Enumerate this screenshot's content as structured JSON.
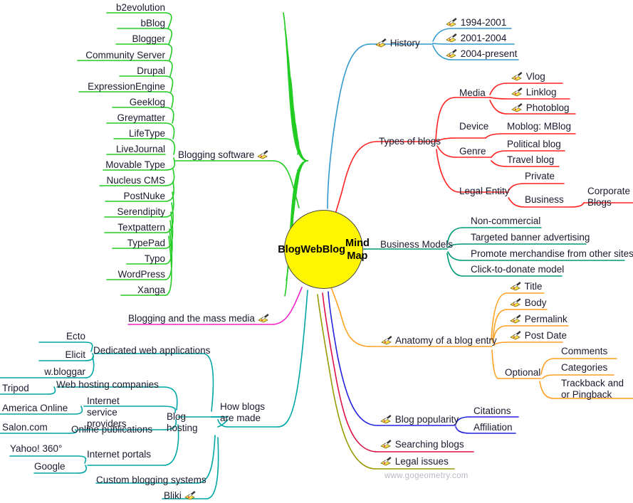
{
  "title": "Blog WebBlog Mind Map",
  "center": {
    "lines": [
      "Blog",
      "WebBlog",
      "Mind Map"
    ],
    "text": "Blog WebBlog Mind Map",
    "fill": "#FFF500",
    "stroke": "#4a4a4a"
  },
  "footer": {
    "text": "www.gogeometry.com"
  },
  "icon": {
    "name": "note-pencil-icon"
  },
  "colors": {
    "blogging_software": "#22cc22",
    "mass_media": "#ee22cc",
    "how_blogs_are_made": "#00a6a6",
    "history": "#3399cc",
    "types_of_blogs": "#ff2222",
    "business_models": "#009977",
    "anatomy": "#ffa022",
    "blog_popularity": "#2222dd",
    "searching_blogs": "#dd1144",
    "legal_issues": "#999900"
  },
  "branches": {
    "blogging_software": {
      "label": "Blogging software",
      "has_icon": true,
      "children": [
        {
          "label": "b2evolution"
        },
        {
          "label": "bBlog"
        },
        {
          "label": "Blogger"
        },
        {
          "label": "Community Server"
        },
        {
          "label": "Drupal"
        },
        {
          "label": "ExpressionEngine"
        },
        {
          "label": "Geeklog"
        },
        {
          "label": "Greymatter"
        },
        {
          "label": "LifeType"
        },
        {
          "label": "LiveJournal"
        },
        {
          "label": "Movable Type"
        },
        {
          "label": "Nucleus CMS"
        },
        {
          "label": "PostNuke"
        },
        {
          "label": "Serendipity"
        },
        {
          "label": "Textpattern"
        },
        {
          "label": "TypePad"
        },
        {
          "label": "Typo"
        },
        {
          "label": "WordPress"
        },
        {
          "label": "Xanga"
        }
      ]
    },
    "mass_media": {
      "label": "Blogging and the mass media",
      "has_icon": true
    },
    "how_blogs_are_made": {
      "label": "How blogs are made",
      "children": [
        {
          "label": "Blog hosting",
          "children": [
            {
              "label": "Dedicated web applications",
              "children": [
                {
                  "label": "Ecto"
                },
                {
                  "label": "Elicit"
                },
                {
                  "label": "w.bloggar"
                }
              ]
            },
            {
              "label": "Web hosting companies",
              "children": [
                {
                  "label": "Tripod"
                }
              ]
            },
            {
              "label": "Internet service providers",
              "children": [
                {
                  "label": "America Online"
                }
              ]
            },
            {
              "label": "Online publications",
              "children": [
                {
                  "label": "Salon.com"
                }
              ]
            },
            {
              "label": "Internet portals",
              "children": [
                {
                  "label": "Yahoo! 360°"
                },
                {
                  "label": "Google"
                }
              ]
            }
          ]
        },
        {
          "label": "Custom blogging systems"
        },
        {
          "label": "Bliki",
          "has_icon": true
        }
      ]
    },
    "history": {
      "label": "History",
      "has_icon": true,
      "children": [
        {
          "label": "1994-2001",
          "has_icon": true
        },
        {
          "label": "2001-2004",
          "has_icon": true
        },
        {
          "label": "2004-present",
          "has_icon": true
        }
      ]
    },
    "types_of_blogs": {
      "label": "Types of blogs",
      "children": [
        {
          "label": "Media",
          "children": [
            {
              "label": "Vlog",
              "has_icon": true
            },
            {
              "label": "Linklog",
              "has_icon": true
            },
            {
              "label": "Photoblog",
              "has_icon": true
            }
          ]
        },
        {
          "label": "Device",
          "children": [
            {
              "label": "Moblog: MBlog"
            }
          ]
        },
        {
          "label": "Genre",
          "children": [
            {
              "label": "Political blog"
            },
            {
              "label": "Travel blog"
            }
          ]
        },
        {
          "label": "Legal Entity",
          "children": [
            {
              "label": "Private"
            },
            {
              "label": "Business",
              "children": [
                {
                  "label": "Corporate Blogs"
                }
              ]
            }
          ]
        }
      ]
    },
    "business_models": {
      "label": "Business Models",
      "children": [
        {
          "label": "Non-commercial"
        },
        {
          "label": "Targeted banner advertising"
        },
        {
          "label": "Promote merchandise from other sites"
        },
        {
          "label": "Click-to-donate model"
        }
      ]
    },
    "anatomy": {
      "label": "Anatomy of a blog entry",
      "has_icon": true,
      "children": [
        {
          "label": "Title",
          "has_icon": true
        },
        {
          "label": "Body",
          "has_icon": true
        },
        {
          "label": "Permalink",
          "has_icon": true
        },
        {
          "label": "Post Date",
          "has_icon": true
        },
        {
          "label": "Optional",
          "children": [
            {
              "label": "Comments"
            },
            {
              "label": "Categories"
            },
            {
              "label": "Trackback and or Pingback"
            }
          ]
        }
      ]
    },
    "blog_popularity": {
      "label": "Blog popularity",
      "has_icon": true,
      "children": [
        {
          "label": "Citations"
        },
        {
          "label": "Affiliation"
        }
      ]
    },
    "searching_blogs": {
      "label": "Searching blogs",
      "has_icon": true
    },
    "legal_issues": {
      "label": "Legal issues",
      "has_icon": true
    }
  }
}
